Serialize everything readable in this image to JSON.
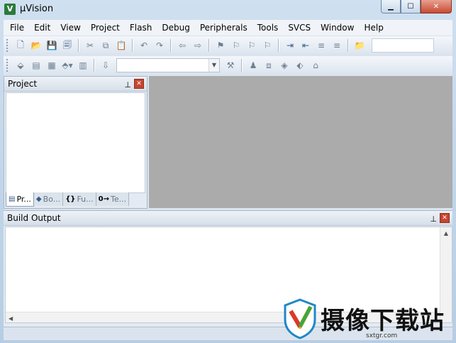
{
  "window": {
    "title": "µVision"
  },
  "menu": [
    "File",
    "Edit",
    "View",
    "Project",
    "Flash",
    "Debug",
    "Peripherals",
    "Tools",
    "SVCS",
    "Window",
    "Help"
  ],
  "project_panel": {
    "title": "Project",
    "tabs": [
      {
        "label": "Pr...",
        "icon": "project-icon"
      },
      {
        "label": "Bo...",
        "icon": "books-icon"
      },
      {
        "label": "Fu...",
        "icon": "functions-icon"
      },
      {
        "label": "Te...",
        "icon": "templates-icon"
      }
    ]
  },
  "build_panel": {
    "title": "Build Output"
  },
  "watermark": {
    "text": "摄像下载站",
    "url": "sxtgr.com"
  }
}
